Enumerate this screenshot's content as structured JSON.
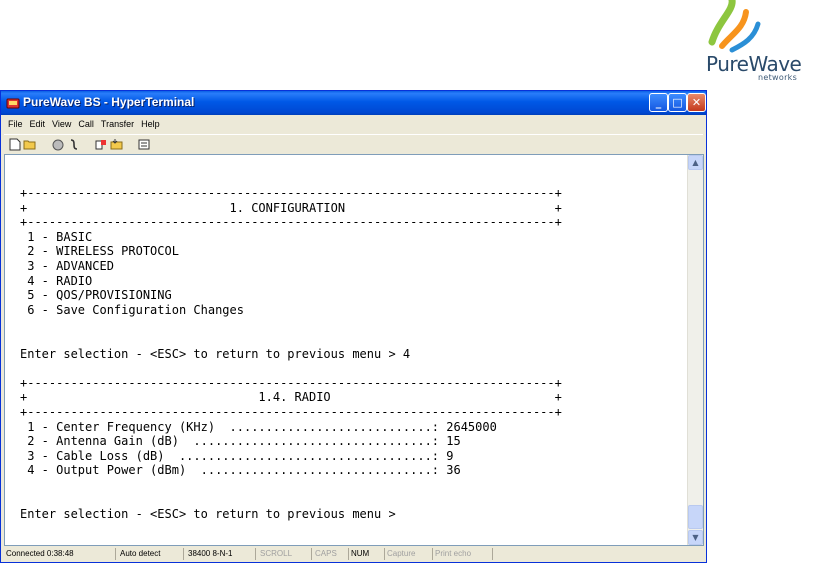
{
  "logo": {
    "name": "PureWave",
    "subtitle": "networks"
  },
  "window": {
    "title": "PureWave BS - HyperTerminal",
    "controls": {
      "minimize": "_",
      "maximize": "□",
      "close": "✕"
    },
    "menu": [
      "File",
      "Edit",
      "View",
      "Call",
      "Transfer",
      "Help"
    ],
    "toolbar_icons": [
      "new-connection-icon",
      "open-icon",
      "connect-icon",
      "disconnect-icon",
      "send-icon",
      "receive-icon",
      "properties-icon"
    ]
  },
  "terminal": {
    "lines": [
      "+-------------------------------------------------------------------------+",
      "+                            1. CONFIGURATION                             +",
      "+-------------------------------------------------------------------------+",
      " 1 - BASIC",
      " 2 - WIRELESS PROTOCOL",
      " 3 - ADVANCED",
      " 4 - RADIO",
      " 5 - QOS/PROVISIONING",
      " 6 - Save Configuration Changes",
      "",
      "",
      "Enter selection - <ESC> to return to previous menu > 4",
      "",
      "+-------------------------------------------------------------------------+",
      "+                                1.4. RADIO                               +",
      "+-------------------------------------------------------------------------+",
      " 1 - Center Frequency (KHz)  ............................: 2645000",
      " 2 - Antenna Gain (dB)  .................................: 15",
      " 3 - Cable Loss (dB)  ...................................: 9",
      " 4 - Output Power (dBm)  ................................: 36",
      "",
      "",
      "Enter selection - <ESC> to return to previous menu >"
    ]
  },
  "statusbar": {
    "connected": "Connected 0:38:48",
    "detect": "Auto detect",
    "settings": "38400 8-N-1",
    "scroll": "SCROLL",
    "caps": "CAPS",
    "num": "NUM",
    "capture": "Capture",
    "print_echo": "Print echo"
  },
  "colors": {
    "titlebar": "#0058e6",
    "window_bg": "#ece9d8",
    "logo_green": "#8dc63f",
    "logo_orange": "#f7941d",
    "logo_blue": "#2b8fd6"
  }
}
